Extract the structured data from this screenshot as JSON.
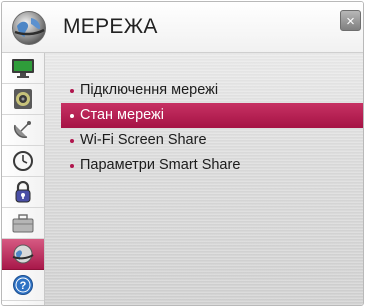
{
  "header": {
    "title": "МЕРЕЖА",
    "globe_icon": "globe-icon",
    "close_label": "×"
  },
  "sidebar": {
    "items": [
      {
        "name": "picture-icon",
        "active": false
      },
      {
        "name": "audio-icon",
        "active": false
      },
      {
        "name": "channels-satellite-icon",
        "active": false
      },
      {
        "name": "time-clock-icon",
        "active": false
      },
      {
        "name": "lock-icon",
        "active": false
      },
      {
        "name": "options-briefcase-icon",
        "active": false
      },
      {
        "name": "network-globe-icon",
        "active": true
      },
      {
        "name": "support-help-icon",
        "active": false
      }
    ]
  },
  "menu": {
    "items": [
      {
        "label": "Підключення мережі",
        "selected": false
      },
      {
        "label": "Стан мережі",
        "selected": true
      },
      {
        "label": "Wi-Fi Screen Share",
        "selected": false
      },
      {
        "label": "Параметри Smart Share",
        "selected": false
      }
    ]
  },
  "colors": {
    "accent": "#b0164d",
    "selected_bg": "#b8214f"
  }
}
